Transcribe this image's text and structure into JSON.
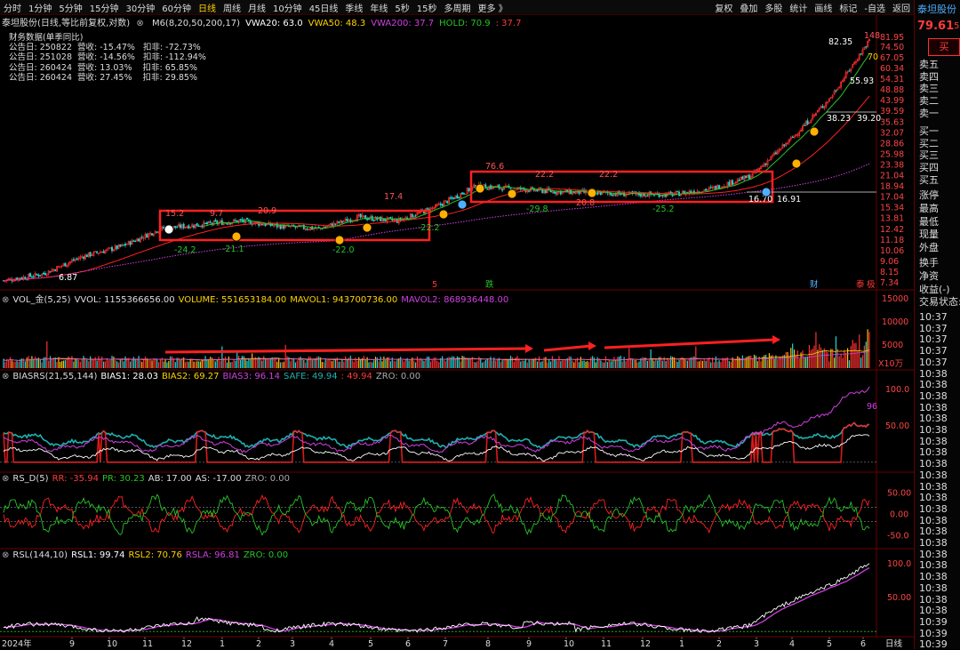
{
  "toolbar": {
    "periods": [
      "分时",
      "1分钟",
      "5分钟",
      "15分钟",
      "30分钟",
      "60分钟",
      "日线",
      "周线",
      "月线",
      "10分钟",
      "45日线",
      "季线",
      "年线",
      "5秒",
      "15秒",
      "多周期",
      "更多 》"
    ],
    "active_period": "日线",
    "right": [
      "复权",
      "叠加",
      "多股",
      "统计",
      "画线",
      "标记",
      "-自选",
      "返回"
    ]
  },
  "stock": {
    "name": "泰坦股份",
    "price": "79.61",
    "price_trail": "5.",
    "buy": "买"
  },
  "main_info": {
    "title": "泰坦股份(日线,等比前复权,对数)",
    "params": [
      {
        "t": "M6(8,20,50,200,17)",
        "c": "#dddddd"
      },
      {
        "t": "VWA20: 63.0",
        "c": "#ffffff"
      },
      {
        "t": "VWA50: 48.3",
        "c": "#ffd200"
      },
      {
        "t": "VWA200: 37.7",
        "c": "#d040e0"
      },
      {
        "t": "HOLD: 70.9",
        "c": "#27c327"
      },
      {
        "t": ": 37.7",
        "c": "#ff3b3b"
      }
    ]
  },
  "financial": {
    "title": "财务数据(单季同比)",
    "rows": [
      "公告日: 250822  营收: -15.47%   扣非: -72.73%",
      "公告日: 251028  营收: -14.56%   扣非: -112.94%",
      "公告日: 260424  营收: 13.03%    扣非: 65.85%",
      "公告日: 260424  营收: 27.45%    扣非: 29.85%"
    ]
  },
  "price_annotations": [
    "6.87",
    "15.2",
    "9.7",
    "-24.2",
    "-21.1",
    "20.9",
    "-22.0",
    "17.4",
    "-22.2",
    "76.6",
    "22.2",
    "22.2",
    "-29.8",
    "20.8",
    "-25.2",
    "16.70",
    "16.91",
    "82.35",
    "148",
    "70",
    "55.93",
    "38.23",
    "39.20",
    "5",
    "跌",
    "财",
    "泰",
    "极"
  ],
  "y_axis_main": [
    "81.95",
    "74.50",
    "67.05",
    "60.34",
    "54.31",
    "48.88",
    "43.99",
    "39.59",
    "35.63",
    "32.07",
    "28.86",
    "25.98",
    "23.38",
    "21.04",
    "18.94",
    "17.04",
    "15.34",
    "13.81",
    "12.42",
    "11.18",
    "10.06",
    "9.06",
    "8.15",
    "7.34"
  ],
  "x_axis": [
    "2024年",
    "9",
    "10",
    "11",
    "12",
    "1",
    "2",
    "3",
    "4",
    "5",
    "6",
    "7",
    "8",
    "9",
    "10",
    "11",
    "12",
    "1",
    "2",
    "3",
    "4",
    "5",
    "6",
    "日线"
  ],
  "panels": {
    "vol": {
      "label": "VOL_金(5,25)",
      "params": [
        {
          "t": "VVOL: 1155366656.00",
          "c": "#dddddd"
        },
        {
          "t": "VOLUME: 551653184.00",
          "c": "#ffd200"
        },
        {
          "t": "MAVOL1: 943700736.00",
          "c": "#ffd200"
        },
        {
          "t": "MAVOL2: 868936448.00",
          "c": "#d040e0"
        }
      ],
      "axis": [
        "15000",
        "10000",
        "5000",
        "X10万"
      ]
    },
    "biasrs": {
      "label": "BIASRS(21,55,144)",
      "params": [
        {
          "t": "BIAS1: 28.03",
          "c": "#ffffff"
        },
        {
          "t": "BIAS2: 69.27",
          "c": "#ffd200"
        },
        {
          "t": "BIAS3: 96.14",
          "c": "#d040e0"
        },
        {
          "t": "SAFE: 49.94",
          "c": "#1fb0b0"
        },
        {
          "t": ": 49.94",
          "c": "#ff3b3b"
        },
        {
          "t": "ZRO: 0.00",
          "c": "#aaaaaa"
        }
      ],
      "axis": [
        "100.0",
        "50.00",
        "96"
      ]
    },
    "rsd": {
      "label": "RS_D(5)",
      "params": [
        {
          "t": "RR: -35.94",
          "c": "#ff3b3b"
        },
        {
          "t": "PR: 30.23",
          "c": "#27c327"
        },
        {
          "t": "AB: 17.00",
          "c": "#dddddd"
        },
        {
          "t": "AS: -17.00",
          "c": "#dddddd"
        },
        {
          "t": "ZRO: 0.00",
          "c": "#aaaaaa"
        }
      ],
      "axis": [
        "50.00",
        "0.00",
        "-50.0"
      ]
    },
    "rsl": {
      "label": "RSL(144,10)",
      "params": [
        {
          "t": "RSL1: 99.74",
          "c": "#ffffff"
        },
        {
          "t": "RSL2: 70.76",
          "c": "#ffd200"
        },
        {
          "t": "RSLA: 96.81",
          "c": "#d040e0"
        },
        {
          "t": "ZRO: 0.00",
          "c": "#27c327"
        }
      ],
      "axis": [
        "100.0",
        "50.00"
      ]
    }
  },
  "right_panel": {
    "sell": [
      "卖五",
      "卖四",
      "卖三",
      "卖二",
      "卖一"
    ],
    "buy": [
      "买一",
      "买二",
      "买三",
      "买四",
      "买五"
    ],
    "stats": [
      "涨停",
      "最高",
      "最低",
      "现量",
      "外盘"
    ],
    "stats2": [
      "换手",
      "净资",
      "收益(-)",
      "交易状态:"
    ],
    "times": [
      "10:37",
      "10:37",
      "10:37",
      "10:37",
      "10:37",
      "10:38",
      "10:38",
      "10:38",
      "10:38",
      "10:38",
      "10:38",
      "10:38",
      "10:38",
      "10:38",
      "10:38",
      "10:38",
      "10:38",
      "10:38",
      "10:38",
      "10:38",
      "10:38",
      "10:38",
      "10:38",
      "10:38",
      "10:38",
      "10:38",
      "10:38",
      "10:39",
      "10:39",
      "10:39"
    ]
  },
  "chart_data": [
    {
      "type": "candlestick",
      "title": "泰坦股份(日线,等比前复权,对数)",
      "y_scale": "log",
      "ylim": [
        7.34,
        81.95
      ],
      "x": [
        "2024-08",
        "2024-09",
        "2024-10",
        "2024-11",
        "2024-12",
        "2025-01",
        "2025-02",
        "2025-03",
        "2025-04",
        "2025-05",
        "2025-06",
        "2025-07",
        "2025-08",
        "2025-09",
        "2025-10",
        "2025-11",
        "2025-12",
        "2026-01",
        "2026-02",
        "2026-03",
        "2026-04",
        "2026-05",
        "2026-06"
      ],
      "close_approx": [
        7.5,
        8.0,
        9.5,
        10.5,
        12.5,
        13.0,
        13.5,
        12.8,
        12.5,
        14.0,
        13.5,
        15.5,
        19.0,
        18.5,
        18.0,
        17.8,
        17.5,
        17.5,
        18.5,
        21.0,
        30.0,
        45.0,
        79.61
      ],
      "series": [
        {
          "name": "VWA20",
          "values": [
            63.0
          ]
        },
        {
          "name": "VWA50",
          "values": [
            48.3
          ]
        },
        {
          "name": "VWA200",
          "values": [
            37.7
          ]
        },
        {
          "name": "HOLD",
          "values": [
            70.9
          ]
        }
      ]
    },
    {
      "type": "bar",
      "title": "VOL_金(5,25)",
      "ylabel": "X10万",
      "ylim": [
        0,
        15000
      ]
    },
    {
      "type": "line",
      "title": "BIASRS(21,55,144)",
      "series": [
        {
          "name": "BIAS1",
          "values": [
            28.03
          ]
        },
        {
          "name": "BIAS2",
          "values": [
            69.27
          ]
        },
        {
          "name": "BIAS3",
          "values": [
            96.14
          ]
        },
        {
          "name": "SAFE",
          "values": [
            49.94
          ]
        }
      ]
    },
    {
      "type": "line",
      "title": "RS_D(5)",
      "series": [
        {
          "name": "RR",
          "values": [
            -35.94
          ]
        },
        {
          "name": "PR",
          "values": [
            30.23
          ]
        },
        {
          "name": "AB",
          "values": [
            17.0
          ]
        },
        {
          "name": "AS",
          "values": [
            -17.0
          ]
        }
      ]
    },
    {
      "type": "line",
      "title": "RSL(144,10)",
      "series": [
        {
          "name": "RSL1",
          "values": [
            99.74
          ]
        },
        {
          "name": "RSL2",
          "values": [
            70.76
          ]
        },
        {
          "name": "RSLA",
          "values": [
            96.81
          ]
        }
      ]
    }
  ]
}
